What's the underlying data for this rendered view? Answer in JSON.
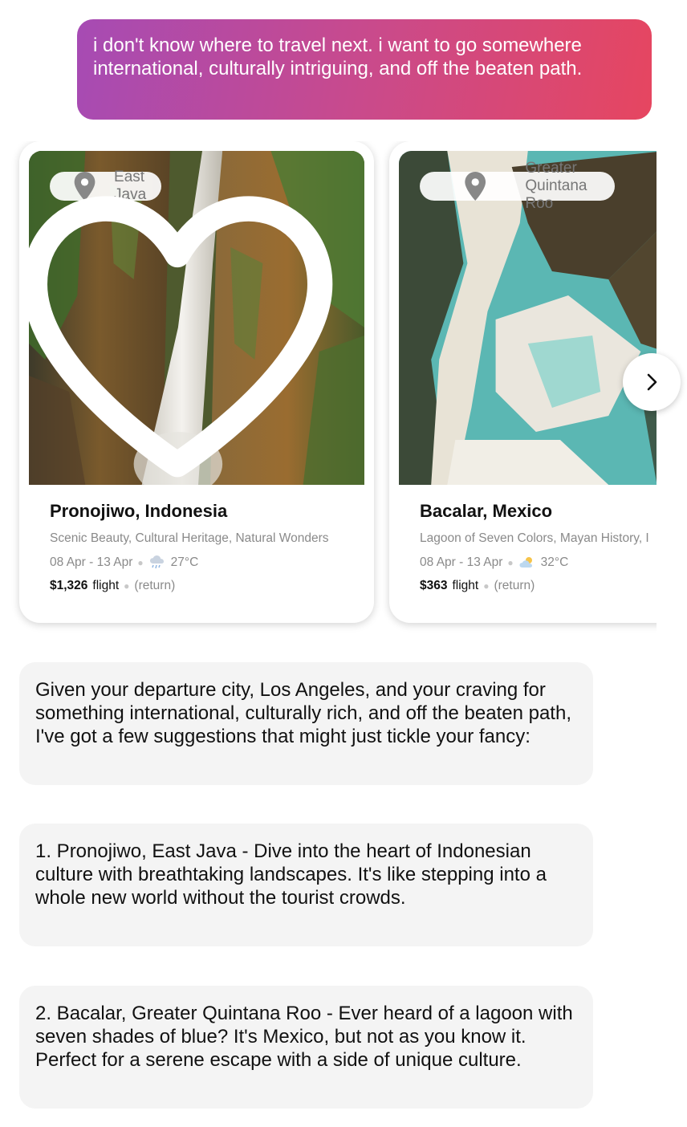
{
  "user_message": "i don't know where to travel next. i want to go somewhere international, culturally intriguing, and off the beaten path.",
  "cards": [
    {
      "location_pill": "East Java",
      "title": "Pronojiwo, Indonesia",
      "tags": "Scenic Beauty, Cultural Heritage, Natural Wonders",
      "dates": "08 Apr - 13 Apr",
      "weather_icon": "rain-cloud-icon",
      "temperature": "27°C",
      "price": "$1,326",
      "price_type": "flight",
      "trip_type": "(return)",
      "favorite_icon": "heart-outline-icon"
    },
    {
      "location_pill": "Greater Quintana Roo",
      "title": "Bacalar, Mexico",
      "tags": "Lagoon of Seven Colors, Mayan History, I",
      "dates": "08 Apr - 13 Apr",
      "weather_icon": "sun-cloud-icon",
      "temperature": "32°C",
      "price": "$363",
      "price_type": "flight",
      "trip_type": "(return)"
    }
  ],
  "carousel_next_icon": "chevron-right-icon",
  "assistant_messages": [
    "Given your departure city, Los Angeles, and your craving for something international, culturally rich, and off the beaten path, I've got a few suggestions that might just tickle your fancy:",
    "1. Pronojiwo, East Java - Dive into the heart of Indonesian culture with breathtaking landscapes. It's like stepping into a whole new world without the tourist crowds.",
    "2. Bacalar, Greater Quintana Roo - Ever heard of a lagoon with seven shades of blue? It's Mexico, but not as you know it. Perfect for a serene escape with a side of unique culture."
  ],
  "colors": {
    "user_bubble_gradient_start": "#a64bb4",
    "user_bubble_gradient_end": "#e64660",
    "assistant_bubble": "#f4f4f4"
  }
}
